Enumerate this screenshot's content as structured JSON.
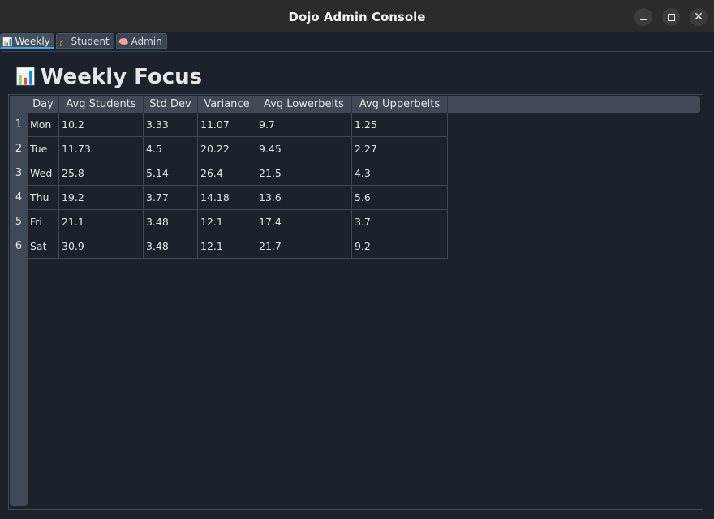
{
  "window": {
    "title": "Dojo Admin Console",
    "controls": {
      "minimize": "minimize",
      "maximize": "maximize",
      "close": "✕"
    }
  },
  "tabs": [
    {
      "icon": "📊",
      "label": "Weekly",
      "active": true
    },
    {
      "icon": "🎓",
      "label": "Student",
      "active": false
    },
    {
      "icon": "🧠",
      "label": "Admin",
      "active": false
    }
  ],
  "main": {
    "heading_icon": "📊",
    "heading": "Weekly Focus"
  },
  "table": {
    "columns": [
      "Day",
      "Avg Students",
      "Std Dev",
      "Variance",
      "Avg Lowerbelts",
      "Avg Upperbelts"
    ],
    "row_numbers": [
      "1",
      "2",
      "3",
      "4",
      "5",
      "6"
    ],
    "rows": [
      [
        "Mon",
        "10.2",
        "3.33",
        "11.07",
        "9.7",
        "1.25"
      ],
      [
        "Tue",
        "11.73",
        "4.5",
        "20.22",
        "9.45",
        "2.27"
      ],
      [
        "Wed",
        "25.8",
        "5.14",
        "26.4",
        "21.5",
        "4.3"
      ],
      [
        "Thu",
        "19.2",
        "3.77",
        "14.18",
        "13.6",
        "5.6"
      ],
      [
        "Fri",
        "21.1",
        "3.48",
        "12.1",
        "17.4",
        "3.7"
      ],
      [
        "Sat",
        "30.9",
        "3.48",
        "12.1",
        "21.7",
        "9.2"
      ]
    ]
  },
  "colors": {
    "background": "#1b222b",
    "header": "#3f4a56",
    "accent": "#4aa3df"
  }
}
